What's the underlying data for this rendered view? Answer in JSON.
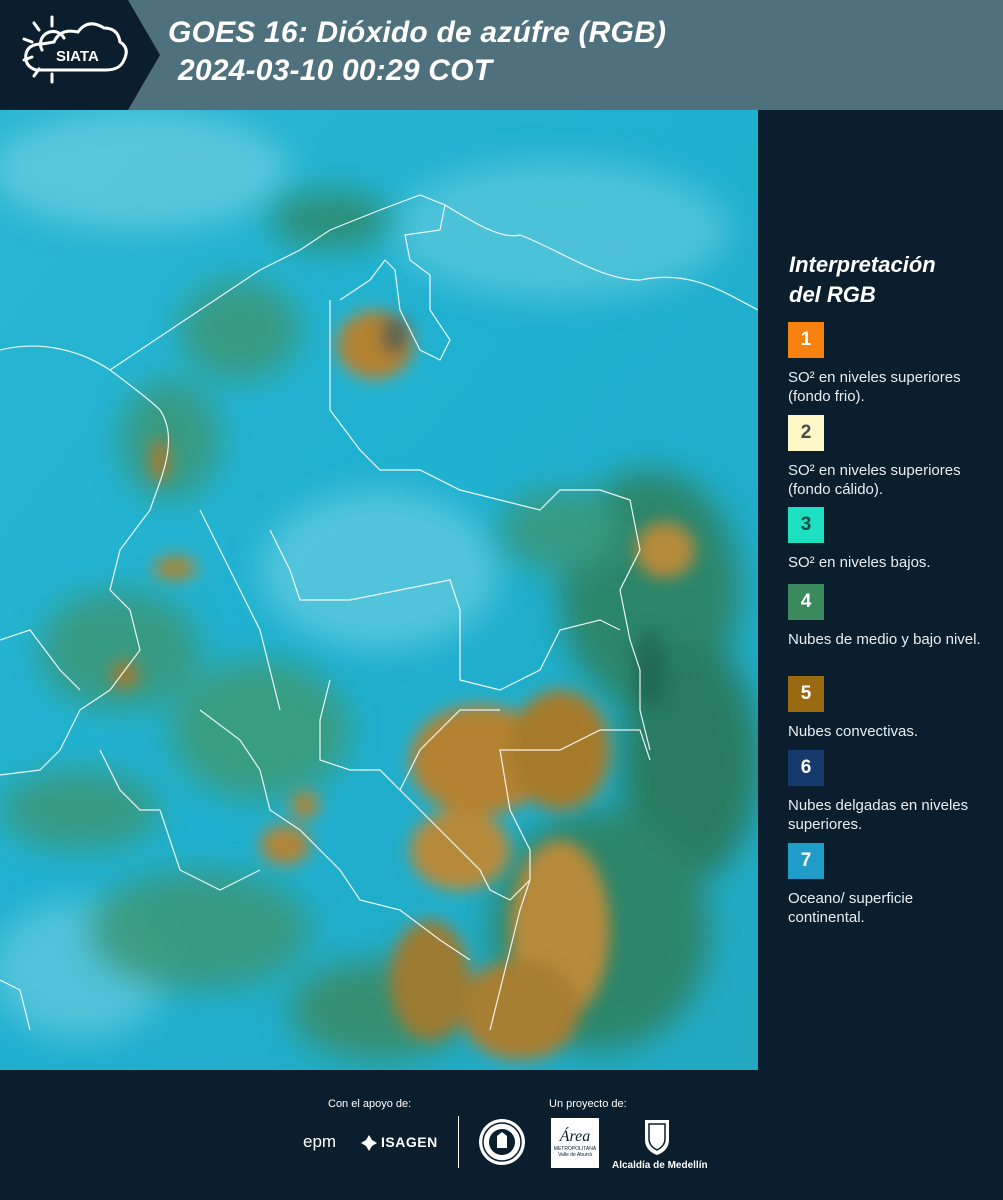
{
  "header": {
    "logo_text": "SIATA",
    "title_line1": "GOES 16: Dióxido de azúfre (RGB)",
    "title_line2": "2024-03-10 00:29 COT"
  },
  "legend": {
    "title_line1": "Interpretación",
    "title_line2": "del RGB",
    "items": [
      {
        "num": "1",
        "color": "#f7820f",
        "num_color": "#ffffff",
        "text": "SO² en niveles superiores (fondo frio)."
      },
      {
        "num": "2",
        "color": "#fdf6c6",
        "num_color": "#4a4a4a",
        "text": "SO² en niveles superiores (fondo cálido)."
      },
      {
        "num": "3",
        "color": "#1de0c0",
        "num_color": "#1a4a44",
        "text": "SO² en niveles bajos."
      },
      {
        "num": "4",
        "color": "#3a8a5e",
        "num_color": "#ffffff",
        "text": "Nubes de medio y bajo nivel."
      },
      {
        "num": "5",
        "color": "#9a6a12",
        "num_color": "#ffffff",
        "text": "Nubes convectivas."
      },
      {
        "num": "6",
        "color": "#163a6c",
        "num_color": "#ffffff",
        "text": "Nubes delgadas en niveles superiores."
      },
      {
        "num": "7",
        "color": "#1f9cc8",
        "num_color": "#ffffff",
        "text": "Oceano/ superficie continental."
      }
    ]
  },
  "footer": {
    "support_label": "Con el apoyo de:",
    "project_label": "Un proyecto de:",
    "epm": "epm",
    "isagen": "ISAGEN",
    "area_name": "Área",
    "area_sub": "METROPOLITANA",
    "area_sub2": "Valle de Aburrá",
    "alcaldia": "Alcaldía de Medellín"
  }
}
